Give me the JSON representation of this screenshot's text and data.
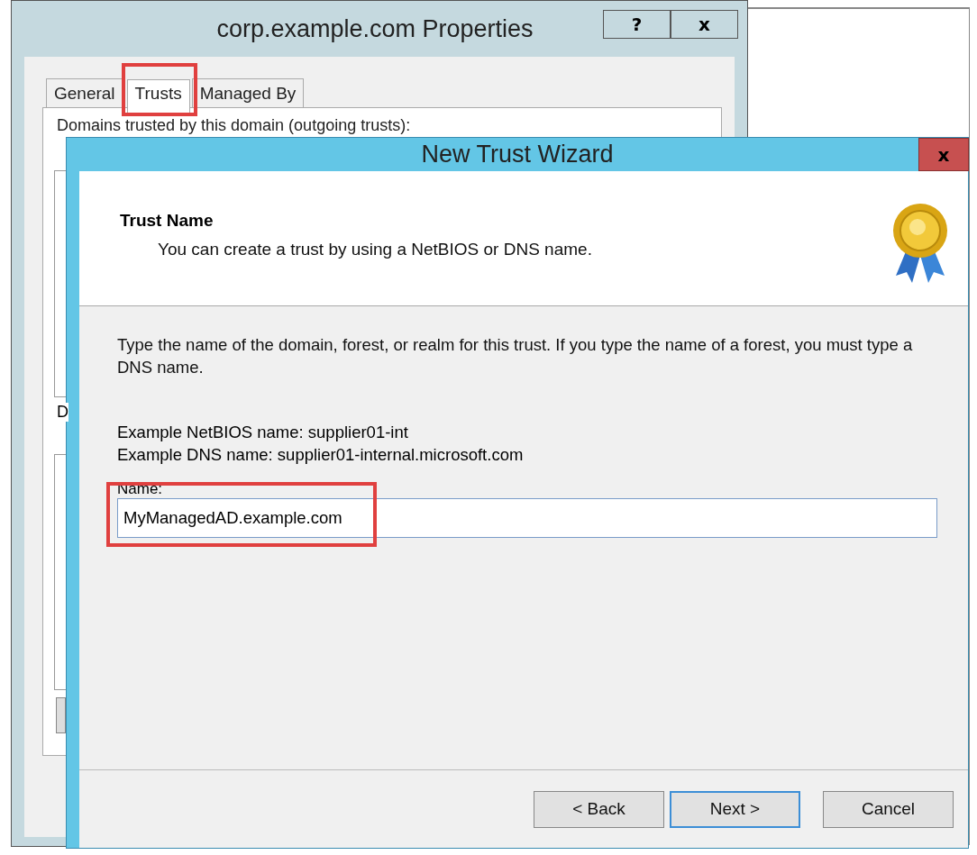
{
  "properties_window": {
    "title": "corp.example.com Properties",
    "title_buttons": [
      "?",
      "x"
    ],
    "tabs": [
      {
        "label": "General",
        "selected": false
      },
      {
        "label": "Trusts",
        "selected": true,
        "highlighted": true
      },
      {
        "label": "Managed By",
        "selected": false
      }
    ],
    "outgoing_label": "Domains trusted by this domain (outgoing trusts):",
    "incoming_label": "D"
  },
  "wizard": {
    "title": "New Trust Wizard",
    "close": "x",
    "heading": "Trust Name",
    "subheading": "You can create a trust by using a NetBIOS or DNS name.",
    "instructions": "Type the name of the domain, forest, or realm for this trust. If you type the name of a forest, you must type a DNS name.",
    "examples": [
      "Example NetBIOS name: supplier01-int",
      "Example DNS name: supplier01-internal.microsoft.com"
    ],
    "name_field": {
      "label": "Name:",
      "value": "MyManagedAD.example.com",
      "highlighted": true
    },
    "buttons": [
      {
        "label": "< Back",
        "default": false
      },
      {
        "label": "Next >",
        "default": true
      },
      {
        "label": "Cancel",
        "default": false
      }
    ]
  }
}
